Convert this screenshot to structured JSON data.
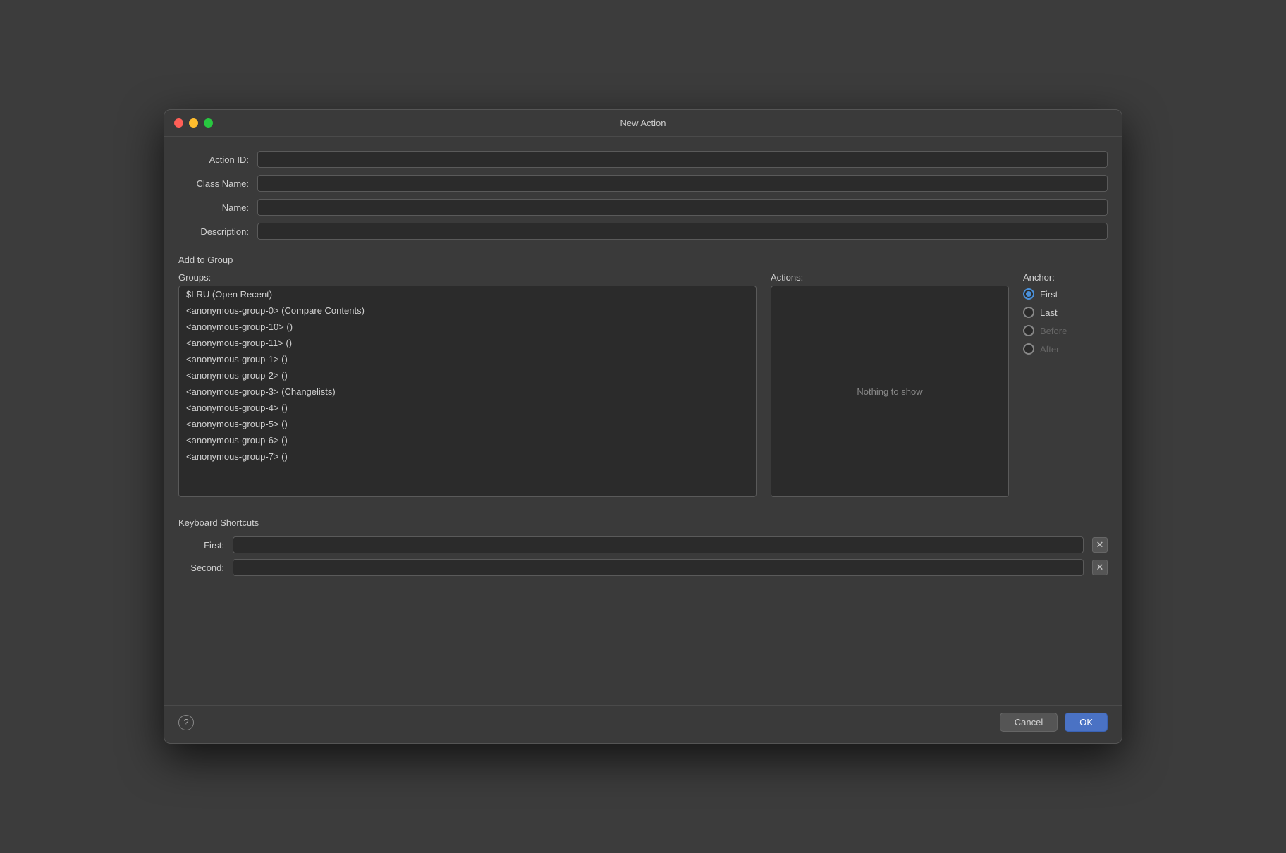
{
  "title": "New Action",
  "fields": {
    "action_id_label": "Action ID:",
    "class_name_label": "Class Name:",
    "name_label": "Name:",
    "description_label": "Description:"
  },
  "add_to_group": {
    "label": "Add to Group",
    "groups_label": "Groups:",
    "actions_label": "Actions:",
    "anchor_label": "Anchor:",
    "nothing_to_show": "Nothing to show",
    "groups": [
      "$LRU (Open Recent)",
      "<anonymous-group-0> (Compare Contents)",
      "<anonymous-group-10> ()",
      "<anonymous-group-11> ()",
      "<anonymous-group-1> ()",
      "<anonymous-group-2> ()",
      "<anonymous-group-3> (Changelists)",
      "<anonymous-group-4> ()",
      "<anonymous-group-5> ()",
      "<anonymous-group-6> ()",
      "<anonymous-group-7> ()"
    ],
    "anchor_options": [
      {
        "value": "first",
        "label": "First",
        "selected": true,
        "disabled": false
      },
      {
        "value": "last",
        "label": "Last",
        "selected": false,
        "disabled": false
      },
      {
        "value": "before",
        "label": "Before",
        "selected": false,
        "disabled": true
      },
      {
        "value": "after",
        "label": "After",
        "selected": false,
        "disabled": true
      }
    ]
  },
  "keyboard_shortcuts": {
    "label": "Keyboard Shortcuts",
    "first_label": "First:",
    "second_label": "Second:"
  },
  "buttons": {
    "help": "?",
    "cancel": "Cancel",
    "ok": "OK"
  },
  "titlebar_buttons": {
    "close": "close",
    "minimize": "minimize",
    "maximize": "maximize"
  }
}
